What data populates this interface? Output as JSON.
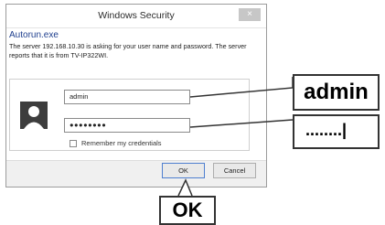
{
  "dialog": {
    "title": "Windows Security",
    "close_label": "×",
    "app_name": "Autorun.exe",
    "message": "The server 192.168.10.30 is asking for your user name and password. The server reports that it is from TV-IP322WI.",
    "username_value": "admin",
    "password_value": "●●●●●●●●",
    "remember_label": "Remember my credentials",
    "ok_label": "OK",
    "cancel_label": "Cancel"
  },
  "callouts": {
    "username": "admin",
    "password": "........|",
    "ok": "OK"
  },
  "colors": {
    "app_name": "#1f3f8e",
    "ok_border": "#4f7fd0"
  }
}
